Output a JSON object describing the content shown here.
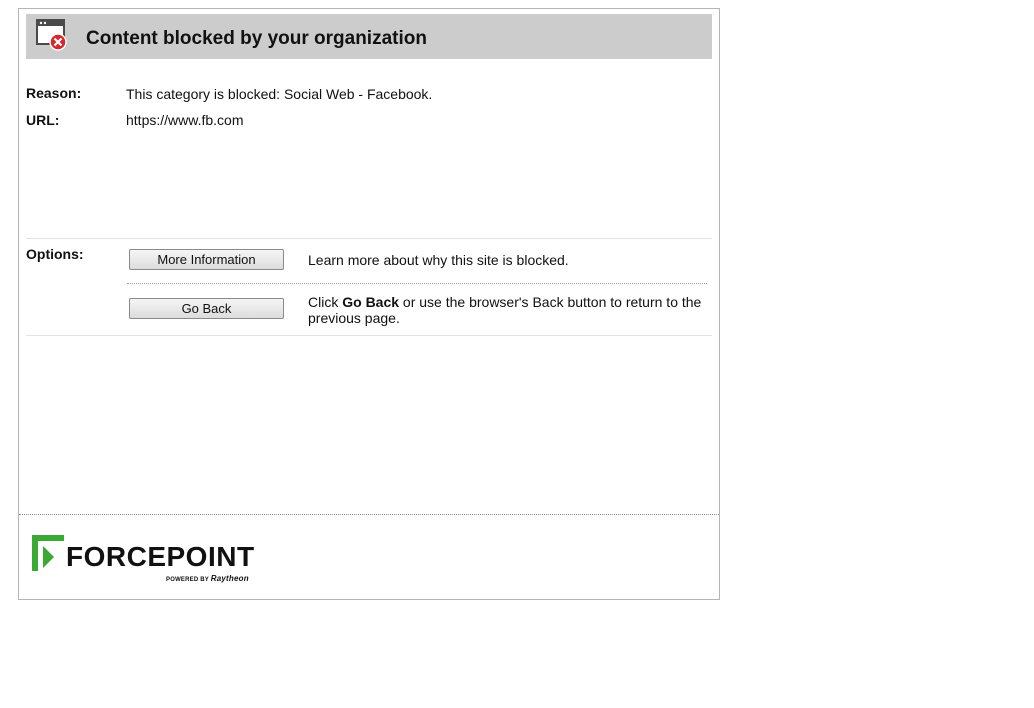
{
  "header": {
    "title": "Content blocked by your organization",
    "icon": "blocked-window-icon"
  },
  "details": {
    "reason_label": "Reason:",
    "reason_value": "This category is blocked: Social Web - Facebook.",
    "url_label": "URL:",
    "url_value": "https://www.fb.com"
  },
  "options": {
    "label": "Options:",
    "more_info": {
      "button_label": "More Information",
      "description": "Learn more about why this site is blocked."
    },
    "go_back": {
      "button_label": "Go Back",
      "desc_prefix": "Click ",
      "desc_bold": "Go Back",
      "desc_suffix": " or use the browser's Back button to return to the previous page."
    }
  },
  "footer": {
    "logo_text": "FORCEPOINT",
    "powered_by": "POWERED BY",
    "powered_brand": "Raytheon"
  },
  "colors": {
    "header_bg": "#cccccc",
    "brand_green": "#3aaa35",
    "blocked_red": "#d9262b"
  }
}
